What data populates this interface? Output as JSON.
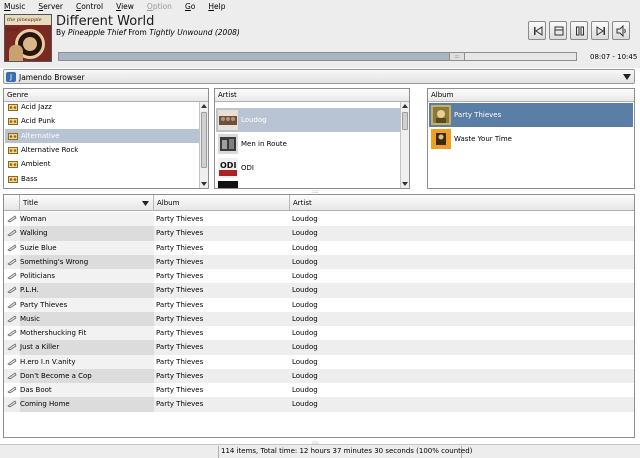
{
  "menu": [
    {
      "label": "Music",
      "u": "M",
      "rest": "usic",
      "disabled": false
    },
    {
      "label": "Server",
      "u": "S",
      "rest": "erver",
      "disabled": false
    },
    {
      "label": "Control",
      "u": "C",
      "rest": "ontrol",
      "disabled": false
    },
    {
      "label": "View",
      "u": "V",
      "rest": "iew",
      "disabled": false
    },
    {
      "label": "Option",
      "u": "O",
      "rest": "ption",
      "disabled": true
    },
    {
      "label": "Go",
      "u": "G",
      "rest": "o",
      "disabled": false
    },
    {
      "label": "Help",
      "u": "H",
      "rest": "elp",
      "disabled": false
    }
  ],
  "now_playing": {
    "album_art_text": "the pineapple thief",
    "title": "Different World",
    "by_label": "By",
    "artist": "Pineapple Thief",
    "from_label": "From",
    "album": "Tightly Unwound (2008)",
    "time": "08:07 - 10:45",
    "progress": 0.77
  },
  "controls": [
    "previous-icon",
    "stop-icon",
    "pause-icon",
    "next-icon",
    "volume-icon"
  ],
  "browser": {
    "label": "Jamendo Browser"
  },
  "genre_pane": {
    "header": "Genre",
    "items": [
      "Acid Jazz",
      "Acid Punk",
      "Alternative",
      "Alternative Rock",
      "Ambient",
      "Bass"
    ],
    "selected_index": 2
  },
  "artist_pane": {
    "header": "Artist",
    "items": [
      "Loudog",
      "Men in Route",
      "ODI"
    ],
    "selected_index": 0
  },
  "album_pane": {
    "header": "Album",
    "items": [
      "Party Thieves",
      "Waste Your Time"
    ],
    "selected_index": 0
  },
  "tracks": {
    "columns": {
      "title": "Title",
      "album": "Album",
      "artist": "Artist"
    },
    "rows": [
      {
        "title": "Woman",
        "album": "Party Thieves",
        "artist": "Loudog"
      },
      {
        "title": "Walking",
        "album": "Party Thieves",
        "artist": "Loudog"
      },
      {
        "title": "Suzie Blue",
        "album": "Party Thieves",
        "artist": "Loudog"
      },
      {
        "title": "Something's Wrong",
        "album": "Party Thieves",
        "artist": "Loudog"
      },
      {
        "title": "Politicians",
        "album": "Party Thieves",
        "artist": "Loudog"
      },
      {
        "title": "P.L.H.",
        "album": "Party Thieves",
        "artist": "Loudog"
      },
      {
        "title": "Party Thieves",
        "album": "Party Thieves",
        "artist": "Loudog"
      },
      {
        "title": "Music",
        "album": "Party Thieves",
        "artist": "Loudog"
      },
      {
        "title": "Mothershucking Fit",
        "album": "Party Thieves",
        "artist": "Loudog"
      },
      {
        "title": "Just a Killer",
        "album": "Party Thieves",
        "artist": "Loudog"
      },
      {
        "title": "H.ero I.n V.anity",
        "album": "Party Thieves",
        "artist": "Loudog"
      },
      {
        "title": "Don't Become a Cop",
        "album": "Party Thieves",
        "artist": "Loudog"
      },
      {
        "title": "Das Boot",
        "album": "Party Thieves",
        "artist": "Loudog"
      },
      {
        "title": "Coming Home",
        "album": "Party Thieves",
        "artist": "Loudog"
      }
    ]
  },
  "status": {
    "text": "114 items,  Total time: 12 hours 37 minutes 30 seconds  (100% counted)"
  },
  "colors": {
    "selection": "#b8c4d4",
    "album_selection": "#5a7ea6",
    "window_bg": "#ededed"
  }
}
